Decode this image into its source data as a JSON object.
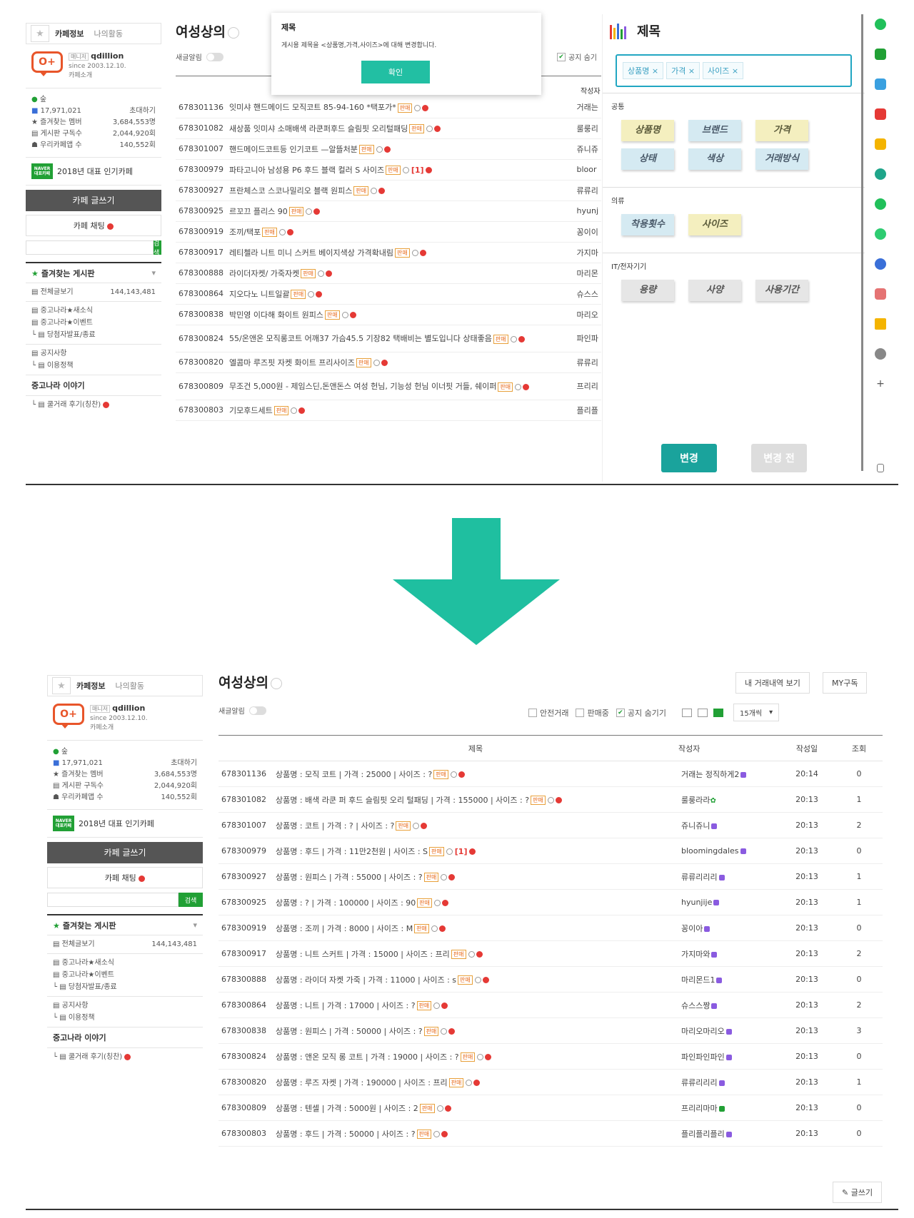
{
  "sidebar": {
    "tab_info": "카페정보",
    "tab_activity": "나의활동",
    "star": "★",
    "logo_text": "O+",
    "manager_tag": "매니저",
    "manager_name": "qdillion",
    "since": "since 2003.12.10.",
    "intro": "카페소개",
    "grade": "숲",
    "members": "17,971,021",
    "invite": "초대하기",
    "stats": [
      {
        "label": "★ 즐겨찾는 멤버",
        "value": "3,684,553명"
      },
      {
        "label": "▤ 게시판 구독수",
        "value": "2,044,920회"
      },
      {
        "label": "☗ 우리카페앱 수",
        "value": "140,552회"
      }
    ],
    "naver_badge": "NAVER",
    "naver_badge_sub": "대표카페",
    "naver_text": "2018년 대표 인기카페",
    "write": "카페 글쓰기",
    "chat": "카페 채팅",
    "search_btn": "검색",
    "fav": "즐겨찾는 게시판",
    "all_label": "▤ 전체글보기",
    "all_count": "144,143,481",
    "list1": [
      "▤ 중고나라★새소식",
      "▤ 중고나라★이벤트",
      "└ ▤ 당첨자발표/종료"
    ],
    "list2": [
      "▤ 공지사항",
      "└ ▤ 이용정책"
    ],
    "story": "중고나라 이야기",
    "story_item": "└ ▤ 쿨거래 후기(칭찬)"
  },
  "top": {
    "board_title": "여성상의",
    "new_alert": "새글알림",
    "notice_hide": "공지 숨기",
    "header_author": "작성자",
    "rows": [
      {
        "num": "678301136",
        "title": "잇미샤 핸드메이드 모직코트 85-94-160 *택포가*",
        "author": "거래는"
      },
      {
        "num": "678301082",
        "title": "새상품 잇미샤 소매배색 라쿤퍼후드 슬림핏 오리털패딩",
        "author": "룰룽리"
      },
      {
        "num": "678301007",
        "title": "핸드메이드코트등 인기코트 —알뜰처분",
        "author": "쥬니쥬"
      },
      {
        "num": "678300979",
        "title": "파타고니아 남성용 P6 후드 블랙 컬러 S 사이즈",
        "author": "bloor",
        "extra": "[1]"
      },
      {
        "num": "678300927",
        "title": "프란체스코 스코나밀리오 블랙 원피스",
        "author": "류류리"
      },
      {
        "num": "678300925",
        "title": "르꼬끄 플리스 90",
        "author": "hyunj"
      },
      {
        "num": "678300919",
        "title": "조끼/택포",
        "author": "꽁이이"
      },
      {
        "num": "678300917",
        "title": "레티첼라 니트 미니 스커트 베이지색상 가격확내림",
        "author": "가지마"
      },
      {
        "num": "678300888",
        "title": "라이더자켓/ 가죽자켓",
        "author": "마리몬"
      },
      {
        "num": "678300864",
        "title": "지오다노 니트일괄",
        "author": "슈스스"
      },
      {
        "num": "678300838",
        "title": "박민영 이다해 화이트 원피스",
        "author": "마리오"
      },
      {
        "num": "678300824",
        "title": "55/온앤온 모직롱코트 어깨37 가슴45.5 기장82 택배비는 별도입니다 상태좋음",
        "author": "파인파"
      },
      {
        "num": "678300820",
        "title": "엘콤마 루즈핏 자켓 화이트 프리사이즈",
        "author": "류류리"
      },
      {
        "num": "678300809",
        "title": "무조건 5,000원 - 제임스딘,돈앤돈스 여성 헌님, 기능성 헌님 이너핏 거들, 쉐이퍼",
        "author": "프리리"
      },
      {
        "num": "678300803",
        "title": "기모후드세트",
        "author": "플리플"
      }
    ]
  },
  "popup": {
    "title": "제목",
    "message": "게시용 제목을 <상품명,가격,사이즈>에 대해 변경합니다.",
    "ok": "확인"
  },
  "ext": {
    "title": "제목",
    "chips": [
      "상품명 ×",
      "가격 ×",
      "사이즈 ×"
    ],
    "sections": [
      {
        "label": "공통",
        "pills": [
          {
            "text": "상품명",
            "tone": "y"
          },
          {
            "text": "브랜드",
            "tone": "b"
          },
          {
            "text": "가격",
            "tone": "y"
          },
          {
            "text": "상태",
            "tone": "b"
          },
          {
            "text": "색상",
            "tone": "b"
          },
          {
            "text": "거래방식",
            "tone": "b"
          }
        ]
      },
      {
        "label": "의류",
        "pills": [
          {
            "text": "착용횟수",
            "tone": "b"
          },
          {
            "text": "사이즈",
            "tone": "y"
          }
        ]
      },
      {
        "label": "IT/전자기기",
        "pills": [
          {
            "text": "용량",
            "tone": "g"
          },
          {
            "text": "사양",
            "tone": "g"
          },
          {
            "text": "사용기간",
            "tone": "g"
          }
        ]
      }
    ],
    "apply": "변경",
    "revert": "변경 전"
  },
  "bottom": {
    "board_title": "여성상의",
    "new_alert": "새글알림",
    "btn_history": "내 거래내역 보기",
    "btn_my": "MY구독",
    "opt_safe": "안전거래",
    "opt_selling": "판매중",
    "opt_notice": "공지 숨기기",
    "per_page": "15개씩",
    "headers": {
      "title": "제목",
      "author": "작성자",
      "date": "작성일",
      "views": "조회"
    },
    "sale_tag": "판매",
    "rows": [
      {
        "num": "678301136",
        "title": "상품명 : 모직 코트 | 가격 : 25000 | 사이즈 : ?",
        "author": "거래는 정직하게2",
        "date": "20:14",
        "views": "0",
        "badge": "p"
      },
      {
        "num": "678301082",
        "title": "상품명 : 배색 라쿤 퍼 후드 슬림핏 오리 털패딩 | 가격 : 155000 | 사이즈 : ?",
        "author": "룰룽라라",
        "date": "20:13",
        "views": "1",
        "badge": "leaf"
      },
      {
        "num": "678301007",
        "title": "상품명 : 코트 | 가격 : ? | 사이즈 : ?",
        "author": "쥬니쥬니",
        "date": "20:13",
        "views": "2",
        "badge": "p"
      },
      {
        "num": "678300979",
        "title": "상품명 : 후드 | 가격 : 11만2천원 | 사이즈 : S",
        "author": "bloomingdales",
        "date": "20:13",
        "views": "0",
        "badge": "p",
        "extra": "[1]"
      },
      {
        "num": "678300927",
        "title": "상품명 : 원피스 | 가격 : 55000 | 사이즈 : ?",
        "author": "류류리리리",
        "date": "20:13",
        "views": "1",
        "badge": "p"
      },
      {
        "num": "678300925",
        "title": "상품명 : ? | 가격 : 100000 | 사이즈 : 90",
        "author": "hyunjije",
        "date": "20:13",
        "views": "1",
        "badge": "p"
      },
      {
        "num": "678300919",
        "title": "상품명 : 조끼 | 가격 : 8000 | 사이즈 : M",
        "author": "꽁이아",
        "date": "20:13",
        "views": "0",
        "badge": "p"
      },
      {
        "num": "678300917",
        "title": "상품명 : 니트 스커트 | 가격 : 15000 | 사이즈 : 프리",
        "author": "가지마와",
        "date": "20:13",
        "views": "2",
        "badge": "p"
      },
      {
        "num": "678300888",
        "title": "상품명 : 라이더 자켓 가죽 | 가격 : 11000 | 사이즈 : s",
        "author": "마리몬드1",
        "date": "20:13",
        "views": "0",
        "badge": "p"
      },
      {
        "num": "678300864",
        "title": "상품명 : 니트 | 가격 : 17000 | 사이즈 : ?",
        "author": "슈스스짱",
        "date": "20:13",
        "views": "2",
        "badge": "p"
      },
      {
        "num": "678300838",
        "title": "상품명 : 원피스 | 가격 : 50000 | 사이즈 : ?",
        "author": "마리오마리오",
        "date": "20:13",
        "views": "3",
        "badge": "p"
      },
      {
        "num": "678300824",
        "title": "상품명 : 앤온 모직 롱 코트 | 가격 : 19000 | 사이즈 : ?",
        "author": "파인파인파인",
        "date": "20:13",
        "views": "0",
        "badge": "p"
      },
      {
        "num": "678300820",
        "title": "상품명 : 루즈 자켓 | 가격 : 190000 | 사이즈 : 프리",
        "author": "류류리리리",
        "date": "20:13",
        "views": "1",
        "badge": "p"
      },
      {
        "num": "678300809",
        "title": "상품명 : 텐셀 | 가격 : 5000원 | 사이즈 : 2",
        "author": "프리리마마",
        "date": "20:13",
        "views": "0",
        "badge": "g"
      },
      {
        "num": "678300803",
        "title": "상품명 : 후드 | 가격 : 50000 | 사이즈 : ?",
        "author": "플리플리플리",
        "date": "20:13",
        "views": "0",
        "badge": "p"
      }
    ],
    "write": "글쓰기"
  },
  "colors": {
    "accent": "#1fbfa0",
    "naver": "#21a035",
    "brand": "#e8552a"
  }
}
